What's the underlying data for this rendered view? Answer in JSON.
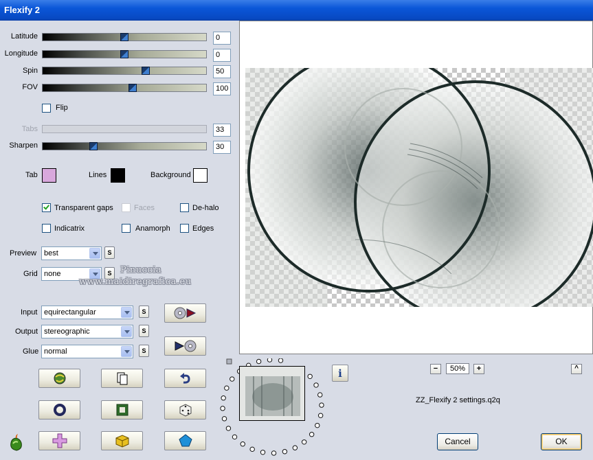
{
  "window": {
    "title": "Flexify 2"
  },
  "sliders": [
    {
      "label": "Latitude",
      "value": "0",
      "fraction": 0.5,
      "enabled": true
    },
    {
      "label": "Longitude",
      "value": "0",
      "fraction": 0.5,
      "enabled": true
    },
    {
      "label": "Spin",
      "value": "50",
      "fraction": 0.63,
      "enabled": true
    },
    {
      "label": "FOV",
      "value": "100",
      "fraction": 0.55,
      "enabled": true
    },
    {
      "label": "Tabs",
      "value": "33",
      "fraction": 0.33,
      "enabled": false
    },
    {
      "label": "Sharpen",
      "value": "30",
      "fraction": 0.31,
      "enabled": true
    }
  ],
  "flip": {
    "label": "Flip",
    "checked": false
  },
  "colors": {
    "tab": {
      "label": "Tab",
      "color": "#d8a8dc"
    },
    "lines": {
      "label": "Lines",
      "color": "#000000"
    },
    "background": {
      "label": "Background",
      "color": "#ffffff"
    }
  },
  "options": {
    "transparent_gaps": {
      "label": "Transparent gaps",
      "checked": true
    },
    "faces": {
      "label": "Faces",
      "checked": false,
      "enabled": false
    },
    "de_halo": {
      "label": "De-halo",
      "checked": false
    },
    "indicatrix": {
      "label": "Indicatrix",
      "checked": false
    },
    "anamorph": {
      "label": "Anamorph",
      "checked": false
    },
    "edges": {
      "label": "Edges",
      "checked": false
    }
  },
  "preview": {
    "label": "Preview",
    "value": "best"
  },
  "grid": {
    "label": "Grid",
    "value": "none"
  },
  "projection": {
    "input": {
      "label": "Input",
      "value": "equirectangular"
    },
    "output": {
      "label": "Output",
      "value": "stereographic"
    },
    "glue": {
      "label": "Glue",
      "value": "normal"
    }
  },
  "s_button_label": "S",
  "watermark": {
    "line1": "Pinuccia",
    "line2": "www.maidiregrafica.eu"
  },
  "zoom": {
    "value": "50%",
    "minus": "−",
    "plus": "+"
  },
  "settings_file": "ZZ_Flexify 2 settings.q2q",
  "buttons": {
    "cancel": "Cancel",
    "ok": "OK",
    "info": "i",
    "collapse": "^"
  },
  "accent_colors": {
    "title_bar": "#0a56d8",
    "slider_thumb": "#1a3a6a"
  }
}
